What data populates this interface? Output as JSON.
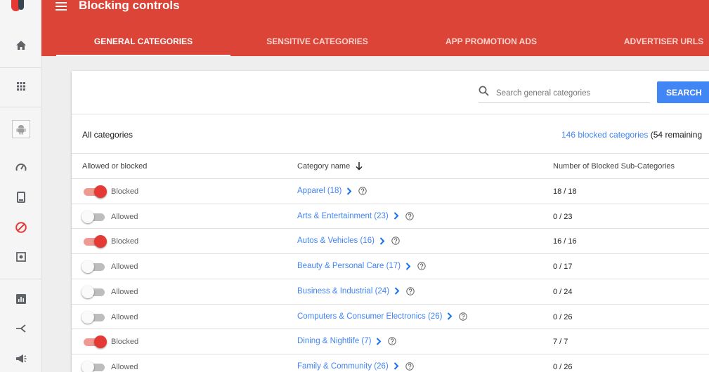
{
  "header": {
    "title": "Blocking controls"
  },
  "tabs": [
    {
      "label": "GENERAL CATEGORIES",
      "active": true
    },
    {
      "label": "SENSITIVE CATEGORIES",
      "active": false
    },
    {
      "label": "APP PROMOTION ADS",
      "active": false
    },
    {
      "label": "ADVERTISER URLS",
      "active": false
    }
  ],
  "rail": {
    "icons": [
      "logo",
      "home-icon",
      "apps-grid-icon",
      "android-icon",
      "speedometer-icon",
      "phone-icon",
      "block-icon",
      "settings-box-icon",
      "bar-chart-icon",
      "merge-icon",
      "megaphone-icon"
    ]
  },
  "search": {
    "placeholder": "Search general categories",
    "button_label": "SEARCH"
  },
  "summary": {
    "all_label": "All categories",
    "blocked_link": "146 blocked categories",
    "remaining": "(54 remaining"
  },
  "table": {
    "headers": {
      "status": "Allowed or blocked",
      "name": "Category name",
      "count": "Number of Blocked Sub-Categories"
    },
    "rows": [
      {
        "blocked": true,
        "status": "Blocked",
        "name": "Apparel (18)",
        "count": "18 / 18"
      },
      {
        "blocked": false,
        "status": "Allowed",
        "name": "Arts & Entertainment (23)",
        "count": "0 / 23"
      },
      {
        "blocked": true,
        "status": "Blocked",
        "name": "Autos & Vehicles (16)",
        "count": "16 / 16"
      },
      {
        "blocked": false,
        "status": "Allowed",
        "name": "Beauty & Personal Care (17)",
        "count": "0 / 17"
      },
      {
        "blocked": false,
        "status": "Allowed",
        "name": "Business & Industrial (24)",
        "count": "0 / 24"
      },
      {
        "blocked": false,
        "status": "Allowed",
        "name": "Computers & Consumer Electronics (26)",
        "count": "0 / 26"
      },
      {
        "blocked": true,
        "status": "Blocked",
        "name": "Dining & Nightlife (7)",
        "count": "7 / 7"
      },
      {
        "blocked": false,
        "status": "Allowed",
        "name": "Family & Community (26)",
        "count": "0 / 26"
      }
    ]
  },
  "colors": {
    "header": "#db4437",
    "accent": "#4285f4",
    "toggle_on": "#e53935"
  }
}
